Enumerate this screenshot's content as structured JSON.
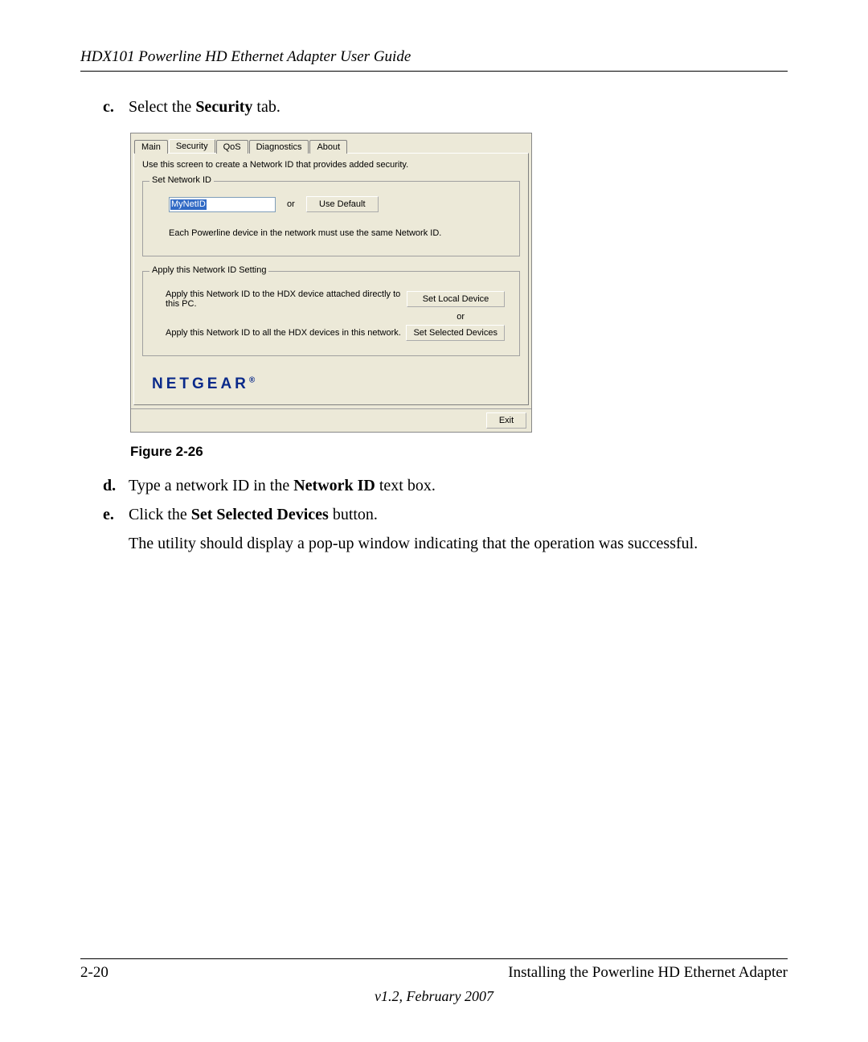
{
  "header": {
    "title": "HDX101 Powerline HD Ethernet Adapter User Guide"
  },
  "steps": {
    "c": {
      "letter": "c.",
      "pre": "Select the ",
      "bold": "Security",
      "post": " tab."
    },
    "d": {
      "letter": "d.",
      "pre": "Type a network ID in the ",
      "bold": "Network ID",
      "post": " text box."
    },
    "e": {
      "letter": "e.",
      "pre": "Click the ",
      "bold": "Set Selected Devices",
      "post": " button."
    },
    "e_cont": "The utility should display a pop-up window indicating that the operation was successful."
  },
  "figure": {
    "caption": "Figure 2-26"
  },
  "dialog": {
    "tabs": {
      "main": "Main",
      "security": "Security",
      "qos": "QoS",
      "diagnostics": "Diagnostics",
      "about": "About"
    },
    "instr": "Use this screen to create a Network ID that provides added security.",
    "group1": {
      "legend": "Set Network ID",
      "input_value": "MyNetID",
      "or": "or",
      "use_default": "Use Default",
      "note": "Each Powerline device in the network must use the same Network ID."
    },
    "group2": {
      "legend": "Apply this Network ID Setting",
      "row1_text": "Apply this Network ID to the HDX device attached directly to this PC.",
      "row1_btn": "Set Local Device",
      "or": "or",
      "row2_text": "Apply this Network ID to all the HDX devices in this network.",
      "row2_btn": "Set Selected Devices"
    },
    "brand": "NETGEAR",
    "exit": "Exit"
  },
  "footer": {
    "page": "2-20",
    "section": "Installing the Powerline HD Ethernet Adapter",
    "version": "v1.2, February 2007"
  }
}
